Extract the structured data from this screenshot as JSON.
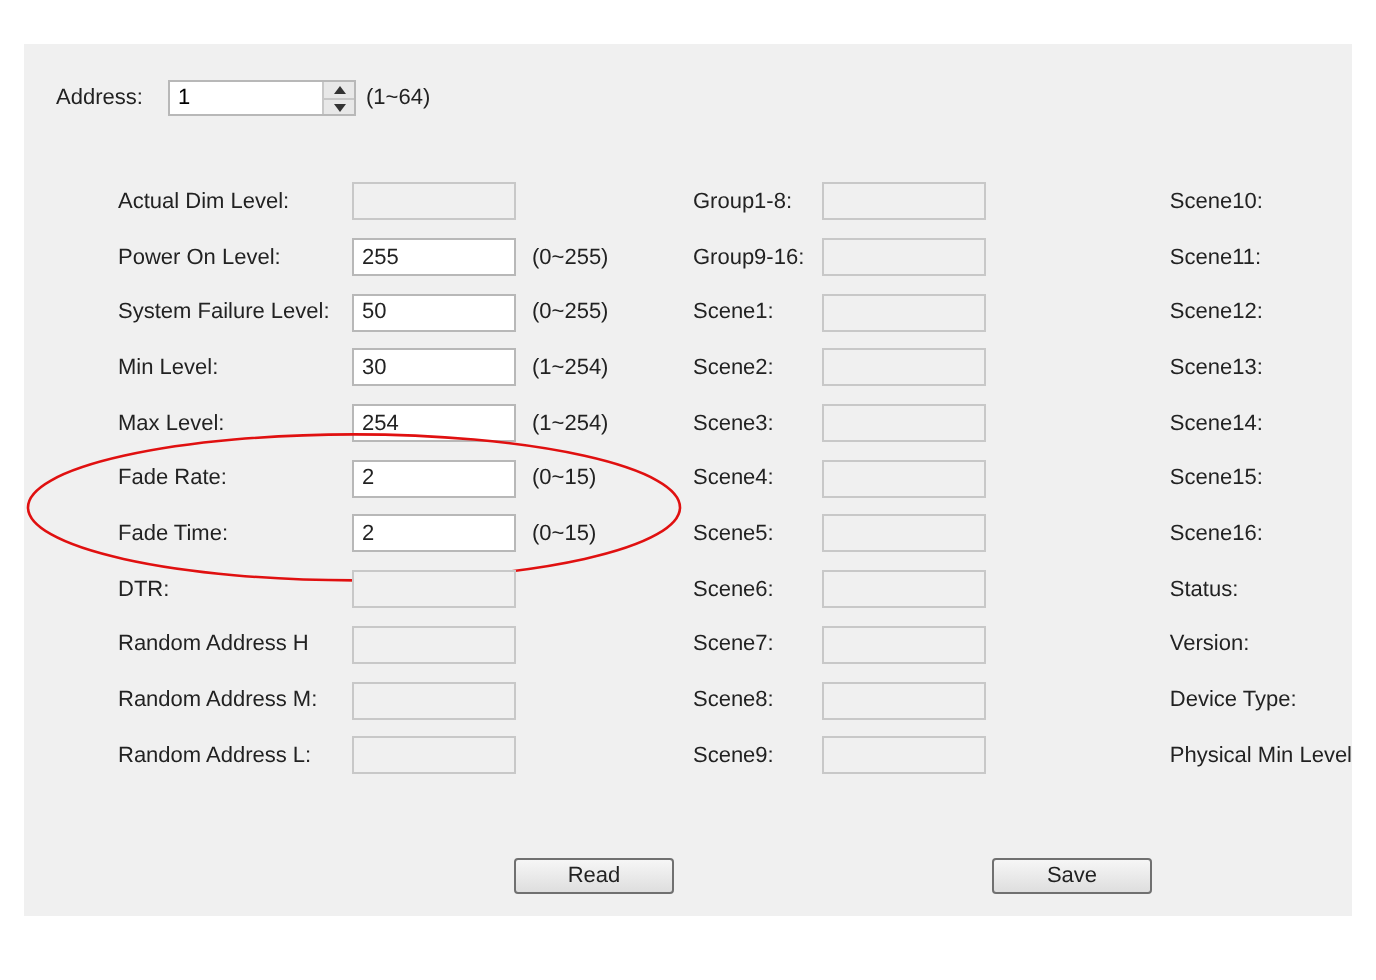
{
  "address": {
    "label": "Address:",
    "value": "1",
    "range": "(1~64)"
  },
  "left_groups": [
    {
      "highlighted": false,
      "fields": [
        {
          "label": "Actual Dim Level:",
          "disabled": true
        },
        {
          "label": "Power On Level:",
          "value": "255",
          "range": "(0~255)",
          "disabled": false
        },
        {
          "label": "System Failure Level:",
          "value": "50",
          "range": "(0~255)",
          "disabled": false
        },
        {
          "label": "Min Level:",
          "value": "30",
          "range": "(1~254)",
          "disabled": false
        },
        {
          "label": "Max Level:",
          "value": "254",
          "range": "(1~254)",
          "disabled": false
        }
      ]
    },
    {
      "highlighted": true,
      "fields": [
        {
          "label": "Fade Rate:",
          "value": "2",
          "range": "(0~15)",
          "disabled": false
        },
        {
          "label": "Fade Time:",
          "value": "2",
          "range": "(0~15)",
          "disabled": false
        }
      ]
    },
    {
      "highlighted": false,
      "fields": [
        {
          "label": "DTR:",
          "disabled": true
        },
        {
          "label": "Random Address H",
          "disabled": true
        },
        {
          "label": "Random Address M:",
          "disabled": true
        },
        {
          "label": "Random Address L:",
          "disabled": true
        }
      ]
    }
  ],
  "middle_fields": [
    {
      "label": "Group1-8:",
      "disabled": true
    },
    {
      "label": "Group9-16:",
      "disabled": true
    },
    {
      "label": "Scene1:",
      "disabled": true
    },
    {
      "label": "Scene2:",
      "disabled": true
    },
    {
      "label": "Scene3:",
      "disabled": true
    },
    {
      "label": "Scene4:",
      "disabled": true
    },
    {
      "label": "Scene5:",
      "disabled": true
    },
    {
      "label": "Scene6:",
      "disabled": true
    },
    {
      "label": "Scene7:",
      "disabled": true
    },
    {
      "label": "Scene8:",
      "disabled": true
    },
    {
      "label": "Scene9:",
      "disabled": true
    }
  ],
  "right_labels": [
    "Scene10:",
    "Scene11:",
    "Scene12:",
    "Scene13:",
    "Scene14:",
    "Scene15:",
    "Scene16:",
    "Status:",
    "Version:",
    "Device Type:",
    "Physical Min Level"
  ],
  "buttons": [
    "Read",
    "Save"
  ]
}
